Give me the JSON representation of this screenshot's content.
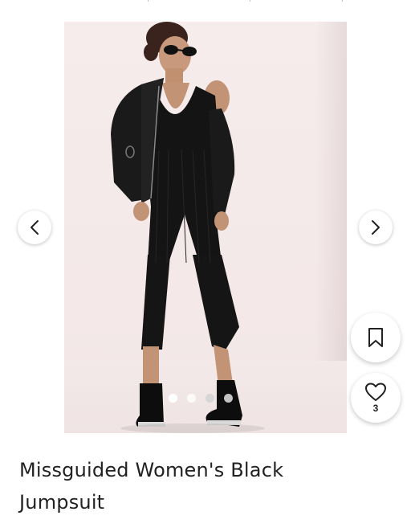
{
  "product": {
    "title": "Missguided Women's Black Jumpsuit",
    "image_alt": "Model wearing black ribbed jumpsuit with bomber jacket"
  },
  "gallery": {
    "prev_icon": "chevron-left-icon",
    "next_icon": "chevron-right-icon",
    "dot_count": 4,
    "active_dot": 0
  },
  "actions": {
    "save_icon": "bookmark-icon",
    "like_icon": "heart-icon",
    "like_count": "3"
  },
  "colors": {
    "background": "#ffffff",
    "text": "#222222",
    "photo_bg": "#f5eaea"
  }
}
